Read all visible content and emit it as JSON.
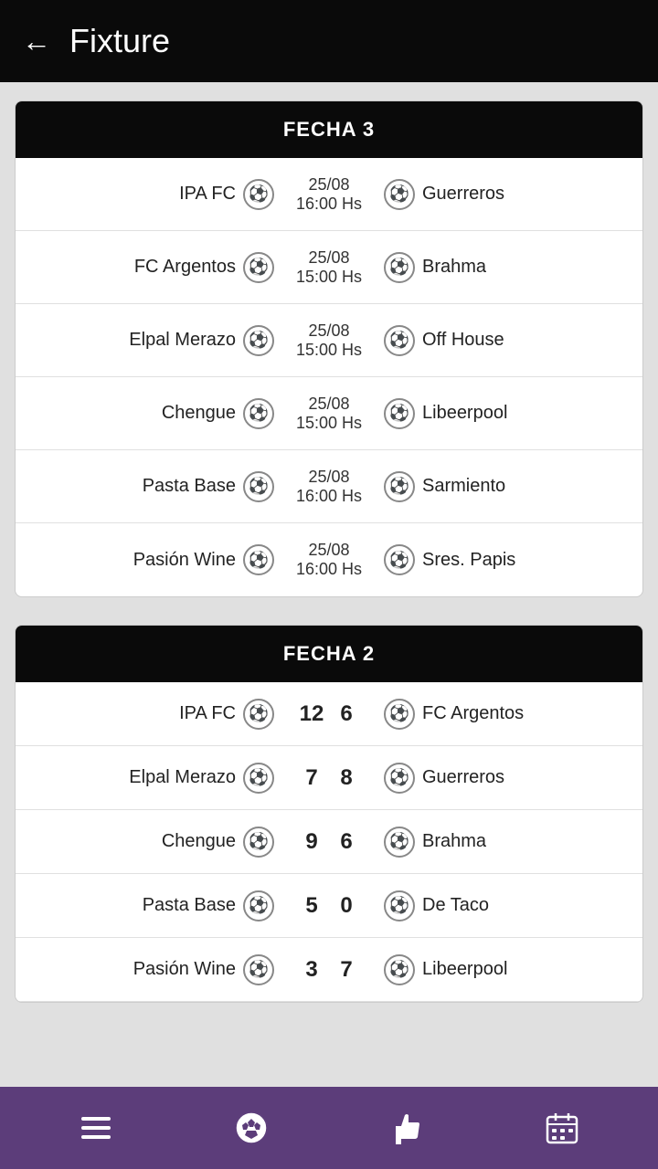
{
  "header": {
    "back_label": "←",
    "title": "Fixture"
  },
  "fecha3": {
    "label": "FECHA 3",
    "matches": [
      {
        "home": "IPA FC",
        "date": "25/08",
        "time": "16:00 Hs",
        "away": "Guerreros"
      },
      {
        "home": "FC Argentos",
        "date": "25/08",
        "time": "15:00 Hs",
        "away": "Brahma"
      },
      {
        "home": "Elpal Merazo",
        "date": "25/08",
        "time": "15:00 Hs",
        "away": "Off House"
      },
      {
        "home": "Chengue",
        "date": "25/08",
        "time": "15:00 Hs",
        "away": "Libeerpool"
      },
      {
        "home": "Pasta Base",
        "date": "25/08",
        "time": "16:00 Hs",
        "away": "Sarmiento"
      },
      {
        "home": "Pasión Wine",
        "date": "25/08",
        "time": "16:00 Hs",
        "away": "Sres. Papis"
      }
    ]
  },
  "fecha2": {
    "label": "FECHA 2",
    "results": [
      {
        "home": "IPA FC",
        "score_home": "12",
        "score_away": "6",
        "away": "FC Argentos"
      },
      {
        "home": "Elpal Merazo",
        "score_home": "7",
        "score_away": "8",
        "away": "Guerreros"
      },
      {
        "home": "Chengue",
        "score_home": "9",
        "score_away": "6",
        "away": "Brahma"
      },
      {
        "home": "Pasta Base",
        "score_home": "5",
        "score_away": "0",
        "away": "De Taco"
      },
      {
        "home": "Pasión Wine",
        "score_home": "3",
        "score_away": "7",
        "away": "Libeerpool"
      }
    ]
  },
  "nav": {
    "items": [
      {
        "icon": "☰",
        "label": "menu-icon"
      },
      {
        "icon": "⚽",
        "label": "soccer-icon"
      },
      {
        "icon": "👍",
        "label": "like-icon"
      },
      {
        "icon": "📅",
        "label": "calendar-icon"
      }
    ]
  }
}
